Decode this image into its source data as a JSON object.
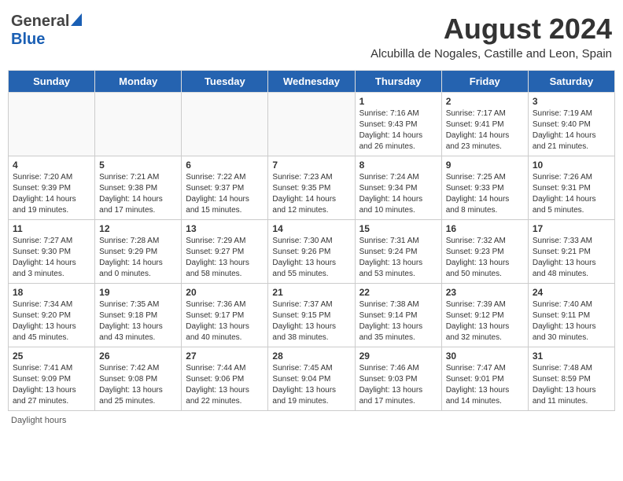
{
  "header": {
    "logo_general": "General",
    "logo_blue": "Blue",
    "main_title": "August 2024",
    "subtitle": "Alcubilla de Nogales, Castille and Leon, Spain"
  },
  "weekdays": [
    "Sunday",
    "Monday",
    "Tuesday",
    "Wednesday",
    "Thursday",
    "Friday",
    "Saturday"
  ],
  "footer": {
    "daylight_label": "Daylight hours"
  },
  "weeks": [
    [
      {
        "day": "",
        "info": ""
      },
      {
        "day": "",
        "info": ""
      },
      {
        "day": "",
        "info": ""
      },
      {
        "day": "",
        "info": ""
      },
      {
        "day": "1",
        "info": "Sunrise: 7:16 AM\nSunset: 9:43 PM\nDaylight: 14 hours and 26 minutes."
      },
      {
        "day": "2",
        "info": "Sunrise: 7:17 AM\nSunset: 9:41 PM\nDaylight: 14 hours and 23 minutes."
      },
      {
        "day": "3",
        "info": "Sunrise: 7:19 AM\nSunset: 9:40 PM\nDaylight: 14 hours and 21 minutes."
      }
    ],
    [
      {
        "day": "4",
        "info": "Sunrise: 7:20 AM\nSunset: 9:39 PM\nDaylight: 14 hours and 19 minutes."
      },
      {
        "day": "5",
        "info": "Sunrise: 7:21 AM\nSunset: 9:38 PM\nDaylight: 14 hours and 17 minutes."
      },
      {
        "day": "6",
        "info": "Sunrise: 7:22 AM\nSunset: 9:37 PM\nDaylight: 14 hours and 15 minutes."
      },
      {
        "day": "7",
        "info": "Sunrise: 7:23 AM\nSunset: 9:35 PM\nDaylight: 14 hours and 12 minutes."
      },
      {
        "day": "8",
        "info": "Sunrise: 7:24 AM\nSunset: 9:34 PM\nDaylight: 14 hours and 10 minutes."
      },
      {
        "day": "9",
        "info": "Sunrise: 7:25 AM\nSunset: 9:33 PM\nDaylight: 14 hours and 8 minutes."
      },
      {
        "day": "10",
        "info": "Sunrise: 7:26 AM\nSunset: 9:31 PM\nDaylight: 14 hours and 5 minutes."
      }
    ],
    [
      {
        "day": "11",
        "info": "Sunrise: 7:27 AM\nSunset: 9:30 PM\nDaylight: 14 hours and 3 minutes."
      },
      {
        "day": "12",
        "info": "Sunrise: 7:28 AM\nSunset: 9:29 PM\nDaylight: 14 hours and 0 minutes."
      },
      {
        "day": "13",
        "info": "Sunrise: 7:29 AM\nSunset: 9:27 PM\nDaylight: 13 hours and 58 minutes."
      },
      {
        "day": "14",
        "info": "Sunrise: 7:30 AM\nSunset: 9:26 PM\nDaylight: 13 hours and 55 minutes."
      },
      {
        "day": "15",
        "info": "Sunrise: 7:31 AM\nSunset: 9:24 PM\nDaylight: 13 hours and 53 minutes."
      },
      {
        "day": "16",
        "info": "Sunrise: 7:32 AM\nSunset: 9:23 PM\nDaylight: 13 hours and 50 minutes."
      },
      {
        "day": "17",
        "info": "Sunrise: 7:33 AM\nSunset: 9:21 PM\nDaylight: 13 hours and 48 minutes."
      }
    ],
    [
      {
        "day": "18",
        "info": "Sunrise: 7:34 AM\nSunset: 9:20 PM\nDaylight: 13 hours and 45 minutes."
      },
      {
        "day": "19",
        "info": "Sunrise: 7:35 AM\nSunset: 9:18 PM\nDaylight: 13 hours and 43 minutes."
      },
      {
        "day": "20",
        "info": "Sunrise: 7:36 AM\nSunset: 9:17 PM\nDaylight: 13 hours and 40 minutes."
      },
      {
        "day": "21",
        "info": "Sunrise: 7:37 AM\nSunset: 9:15 PM\nDaylight: 13 hours and 38 minutes."
      },
      {
        "day": "22",
        "info": "Sunrise: 7:38 AM\nSunset: 9:14 PM\nDaylight: 13 hours and 35 minutes."
      },
      {
        "day": "23",
        "info": "Sunrise: 7:39 AM\nSunset: 9:12 PM\nDaylight: 13 hours and 32 minutes."
      },
      {
        "day": "24",
        "info": "Sunrise: 7:40 AM\nSunset: 9:11 PM\nDaylight: 13 hours and 30 minutes."
      }
    ],
    [
      {
        "day": "25",
        "info": "Sunrise: 7:41 AM\nSunset: 9:09 PM\nDaylight: 13 hours and 27 minutes."
      },
      {
        "day": "26",
        "info": "Sunrise: 7:42 AM\nSunset: 9:08 PM\nDaylight: 13 hours and 25 minutes."
      },
      {
        "day": "27",
        "info": "Sunrise: 7:44 AM\nSunset: 9:06 PM\nDaylight: 13 hours and 22 minutes."
      },
      {
        "day": "28",
        "info": "Sunrise: 7:45 AM\nSunset: 9:04 PM\nDaylight: 13 hours and 19 minutes."
      },
      {
        "day": "29",
        "info": "Sunrise: 7:46 AM\nSunset: 9:03 PM\nDaylight: 13 hours and 17 minutes."
      },
      {
        "day": "30",
        "info": "Sunrise: 7:47 AM\nSunset: 9:01 PM\nDaylight: 13 hours and 14 minutes."
      },
      {
        "day": "31",
        "info": "Sunrise: 7:48 AM\nSunset: 8:59 PM\nDaylight: 13 hours and 11 minutes."
      }
    ]
  ]
}
